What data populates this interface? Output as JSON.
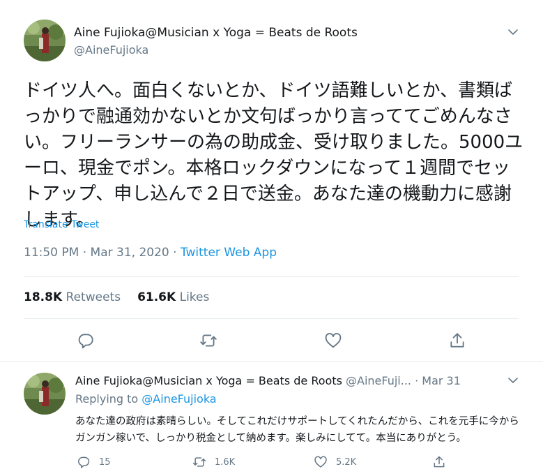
{
  "main_tweet": {
    "display_name": "Aine Fujioka@Musician x Yoga = Beats de Roots",
    "handle": "@AineFujioka",
    "text": "ドイツ人へ。面白くないとか、ドイツ語難しいとか、書類ばっかりで融通効かないとか文句ばっかり言っててごめんなさい。フリーランサーの為の助成金、受け取りました。5000ユーロ、現金でポン。本格ロックダウンになって１週間でセットアップ、申し込んで２日で送金。あなた達の機動力に感謝します。",
    "translate_label": "Translate Tweet",
    "time": "11:50 PM · Mar 31, 2020 · ",
    "source": "Twitter Web App",
    "retweets_count": "18.8K",
    "retweets_label": "Retweets",
    "likes_count": "61.6K",
    "likes_label": "Likes"
  },
  "reply_tweet": {
    "display_name": "Aine Fujioka@Musician x Yoga = Beats de Roots",
    "handle": "@AineFuji...",
    "date": " · Mar 31",
    "replying_prefix": "Replying to ",
    "replying_handle": "@AineFujioka",
    "text": "あなた達の政府は素晴らしい。そしてこれだけサポートしてくれたんだから、これを元手に今からガンガン稼いで、しっかり税金として納めます。楽しみにしてて。本当にありがとう。",
    "reply_count": "15",
    "retweet_count": "1.6K",
    "like_count": "5.2K"
  },
  "icons": {
    "reply": "reply-icon",
    "retweet": "retweet-icon",
    "like": "heart-icon",
    "share": "share-icon",
    "caret": "chevron-down-icon"
  },
  "colors": {
    "link": "#1b95e0",
    "secondary_text": "#657786",
    "divider": "#e6ecf0",
    "icon": "#657786"
  }
}
